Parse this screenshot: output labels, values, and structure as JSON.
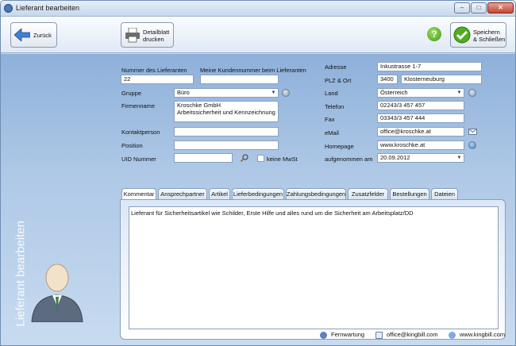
{
  "window": {
    "title": "Lieferant bearbeiten",
    "min": "–",
    "max": "□",
    "close": "✕"
  },
  "toolbar": {
    "back": "Zurück",
    "print_line1": "Detailblatt",
    "print_line2": "drucken",
    "save_line1": "Speichern",
    "save_line2": "& Schließen",
    "help": "?"
  },
  "sidebar": {
    "title": "Lieferant bearbeiten"
  },
  "form": {
    "supplier_no_label": "Nummer des Lieferanten",
    "supplier_no": "22",
    "customer_no_label": "Meine Kundennummer beim Lieferanten",
    "customer_no": "",
    "group_label": "Gruppe",
    "group": "Büro",
    "company_label": "Firmenname",
    "company_line1": "Kroschke GmbH",
    "company_line2": "Arbeitssicherheit und Kennzeichnung",
    "contact_label": "Kontaktperson",
    "contact": "",
    "position_label": "Position",
    "position": "",
    "uid_label": "UID Nummer",
    "uid": "",
    "no_vat_label": "keine MwSt",
    "address_label": "Adresse",
    "address": "Inkustrasse 1-7",
    "zip_label": "PLZ & Ort",
    "zip": "3400",
    "city": "Klosterneuburg",
    "country_label": "Land",
    "country": "Österreich",
    "phone_label": "Telefon",
    "phone": "02243/3 457 457",
    "fax_label": "Fax",
    "fax": "03343/3 457 444",
    "email_label": "eMail",
    "email": "office@kroschke.at",
    "homepage_label": "Homepage",
    "homepage": "www.kroschke.at",
    "added_label": "aufgenommen am",
    "added": "20.09.2012"
  },
  "tabs": [
    "Kommentar",
    "Ansprechpartner",
    "Artikel",
    "Lieferbedingungen",
    "Zahlungsbedingungen",
    "Zusatzfelder",
    "Bestellungen",
    "Dateien"
  ],
  "comment": "Lieferant für Sicherheitsartikel wie Schilder, Erste Hilfe und alles rund um die Sicherheit am Arbeitsplatz/DD",
  "footer": {
    "remote": "Fernwartung",
    "email": "office@kingbill.com",
    "web": "www.kingbill.com"
  }
}
